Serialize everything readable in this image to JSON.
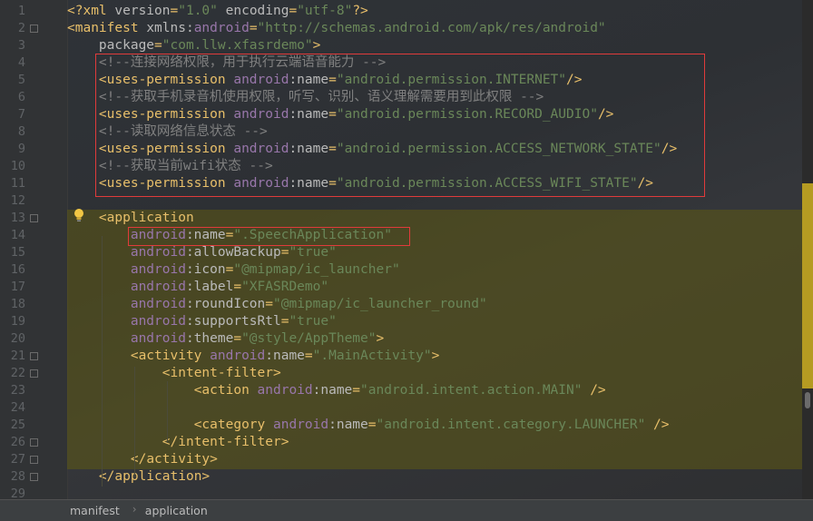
{
  "editor": {
    "line_numbers": [
      "1",
      "2",
      "3",
      "4",
      "5",
      "6",
      "7",
      "8",
      "9",
      "10",
      "11",
      "12",
      "13",
      "14",
      "15",
      "16",
      "17",
      "18",
      "19",
      "20",
      "21",
      "22",
      "23",
      "24",
      "25",
      "26",
      "27",
      "28",
      "29"
    ],
    "lines": [
      [
        [
          "t-pun",
          "<?"
        ],
        [
          "t-tag",
          "xml "
        ],
        [
          "t-attr",
          "version"
        ],
        [
          "t-pun",
          "="
        ],
        [
          "t-val",
          "\"1.0\""
        ],
        [
          "t-plain",
          " "
        ],
        [
          "t-attr",
          "encoding"
        ],
        [
          "t-pun",
          "="
        ],
        [
          "t-val",
          "\"utf-8\""
        ],
        [
          "t-pun",
          "?>"
        ]
      ],
      [
        [
          "t-pun",
          "<"
        ],
        [
          "t-tag",
          "manifest "
        ],
        [
          "t-attr",
          "xmlns:"
        ],
        [
          "t-ns",
          "android"
        ],
        [
          "t-pun",
          "="
        ],
        [
          "t-val",
          "\"http://schemas.android.com/apk/res/android\""
        ]
      ],
      [
        [
          "t-plain",
          "    "
        ],
        [
          "t-attr",
          "package"
        ],
        [
          "t-pun",
          "="
        ],
        [
          "t-val",
          "\"com.llw.xfasrdemo\""
        ],
        [
          "t-pun",
          ">"
        ]
      ],
      [
        [
          "t-com",
          "    <!--连接网络权限，用于执行云端语音能力 -->"
        ]
      ],
      [
        [
          "t-plain",
          "    "
        ],
        [
          "t-pun",
          "<"
        ],
        [
          "t-tag",
          "uses-permission "
        ],
        [
          "t-ns",
          "android"
        ],
        [
          "t-attr",
          ":name"
        ],
        [
          "t-pun",
          "="
        ],
        [
          "t-val",
          "\"android.permission.INTERNET\""
        ],
        [
          "t-pun",
          "/>"
        ]
      ],
      [
        [
          "t-com",
          "    <!--获取手机录音机使用权限，听写、识别、语义理解需要用到此权限 -->"
        ]
      ],
      [
        [
          "t-plain",
          "    "
        ],
        [
          "t-pun",
          "<"
        ],
        [
          "t-tag",
          "uses-permission "
        ],
        [
          "t-ns",
          "android"
        ],
        [
          "t-attr",
          ":name"
        ],
        [
          "t-pun",
          "="
        ],
        [
          "t-val",
          "\"android.permission.RECORD_AUDIO\""
        ],
        [
          "t-pun",
          "/>"
        ]
      ],
      [
        [
          "t-com",
          "    <!--读取网络信息状态 -->"
        ]
      ],
      [
        [
          "t-plain",
          "    "
        ],
        [
          "t-pun",
          "<"
        ],
        [
          "t-tag",
          "uses-permission "
        ],
        [
          "t-ns",
          "android"
        ],
        [
          "t-attr",
          ":name"
        ],
        [
          "t-pun",
          "="
        ],
        [
          "t-val",
          "\"android.permission.ACCESS_NETWORK_STATE\""
        ],
        [
          "t-pun",
          "/>"
        ]
      ],
      [
        [
          "t-com",
          "    <!--获取当前wifi状态 -->"
        ]
      ],
      [
        [
          "t-plain",
          "    "
        ],
        [
          "t-pun",
          "<"
        ],
        [
          "t-tag",
          "uses-permission "
        ],
        [
          "t-ns",
          "android"
        ],
        [
          "t-attr",
          ":name"
        ],
        [
          "t-pun",
          "="
        ],
        [
          "t-val",
          "\"android.permission.ACCESS_WIFI_STATE\""
        ],
        [
          "t-pun",
          "/>"
        ]
      ],
      [],
      [
        [
          "t-plain",
          "    "
        ],
        [
          "t-pun",
          "<"
        ],
        [
          "t-tag",
          "application"
        ]
      ],
      [
        [
          "t-plain",
          "        "
        ],
        [
          "t-ns",
          "android"
        ],
        [
          "t-attr",
          ":name"
        ],
        [
          "t-pun",
          "="
        ],
        [
          "t-val",
          "\".SpeechApplication\""
        ]
      ],
      [
        [
          "t-plain",
          "        "
        ],
        [
          "t-ns",
          "android"
        ],
        [
          "t-attr",
          ":allowBackup"
        ],
        [
          "t-pun",
          "="
        ],
        [
          "t-val",
          "\"true\""
        ]
      ],
      [
        [
          "t-plain",
          "        "
        ],
        [
          "t-ns",
          "android"
        ],
        [
          "t-attr",
          ":icon"
        ],
        [
          "t-pun",
          "="
        ],
        [
          "t-val",
          "\"@mipmap/ic_launcher\""
        ]
      ],
      [
        [
          "t-plain",
          "        "
        ],
        [
          "t-ns",
          "android"
        ],
        [
          "t-attr",
          ":label"
        ],
        [
          "t-pun",
          "="
        ],
        [
          "t-val",
          "\"XFASRDemo\""
        ]
      ],
      [
        [
          "t-plain",
          "        "
        ],
        [
          "t-ns",
          "android"
        ],
        [
          "t-attr",
          ":roundIcon"
        ],
        [
          "t-pun",
          "="
        ],
        [
          "t-val",
          "\"@mipmap/ic_launcher_round\""
        ]
      ],
      [
        [
          "t-plain",
          "        "
        ],
        [
          "t-ns",
          "android"
        ],
        [
          "t-attr",
          ":supportsRtl"
        ],
        [
          "t-pun",
          "="
        ],
        [
          "t-val",
          "\"true\""
        ]
      ],
      [
        [
          "t-plain",
          "        "
        ],
        [
          "t-ns",
          "android"
        ],
        [
          "t-attr",
          ":theme"
        ],
        [
          "t-pun",
          "="
        ],
        [
          "t-val",
          "\"@style/AppTheme\""
        ],
        [
          "t-pun",
          ">"
        ]
      ],
      [
        [
          "t-plain",
          "        "
        ],
        [
          "t-pun",
          "<"
        ],
        [
          "t-tag",
          "activity "
        ],
        [
          "t-ns",
          "android"
        ],
        [
          "t-attr",
          ":name"
        ],
        [
          "t-pun",
          "="
        ],
        [
          "t-val",
          "\".MainActivity\""
        ],
        [
          "t-pun",
          ">"
        ]
      ],
      [
        [
          "t-plain",
          "            "
        ],
        [
          "t-pun",
          "<"
        ],
        [
          "t-tag",
          "intent-filter"
        ],
        [
          "t-pun",
          ">"
        ]
      ],
      [
        [
          "t-plain",
          "                "
        ],
        [
          "t-pun",
          "<"
        ],
        [
          "t-tag",
          "action "
        ],
        [
          "t-ns",
          "android"
        ],
        [
          "t-attr",
          ":name"
        ],
        [
          "t-pun",
          "="
        ],
        [
          "t-val",
          "\"android.intent.action.MAIN\""
        ],
        [
          "t-plain",
          " "
        ],
        [
          "t-pun",
          "/>"
        ]
      ],
      [],
      [
        [
          "t-plain",
          "                "
        ],
        [
          "t-pun",
          "<"
        ],
        [
          "t-tag",
          "category "
        ],
        [
          "t-ns",
          "android"
        ],
        [
          "t-attr",
          ":name"
        ],
        [
          "t-pun",
          "="
        ],
        [
          "t-val",
          "\"android.intent.category.LAUNCHER\""
        ],
        [
          "t-plain",
          " "
        ],
        [
          "t-pun",
          "/>"
        ]
      ],
      [
        [
          "t-plain",
          "            "
        ],
        [
          "t-pun",
          "</"
        ],
        [
          "t-tag",
          "intent-filter"
        ],
        [
          "t-pun",
          ">"
        ]
      ],
      [
        [
          "t-plain",
          "        "
        ],
        [
          "t-pun",
          "</"
        ],
        [
          "t-tag",
          "activity"
        ],
        [
          "t-pun",
          ">"
        ]
      ],
      [
        [
          "t-plain",
          "    "
        ],
        [
          "t-pun",
          "</"
        ],
        [
          "t-tag",
          "application"
        ],
        [
          "t-pun",
          ">"
        ]
      ],
      []
    ]
  },
  "breadcrumb": {
    "items": [
      "manifest",
      "application"
    ]
  },
  "colors": {
    "highlight_box": "#e03b3b",
    "selection_band": "#5f5a14"
  },
  "icons": {
    "intention": "lightbulb-icon",
    "separator": "chevron-right-icon"
  }
}
